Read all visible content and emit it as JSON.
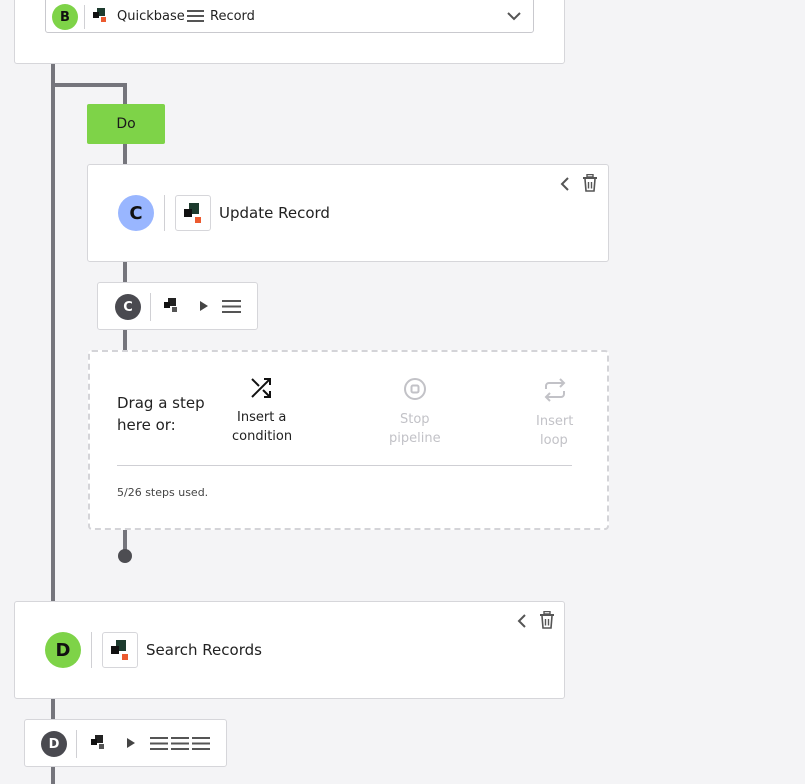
{
  "step_b": {
    "badge": "B",
    "app_name": "Quickbase",
    "entity": "Record",
    "badge_color": "#7ed348"
  },
  "do_block": {
    "label": "Do",
    "color": "#7ed348"
  },
  "step_c": {
    "badge": "C",
    "title": "Update Record",
    "badge_color": "#99b6ff"
  },
  "step_c_mini": {
    "badge": "C"
  },
  "drop_zone": {
    "drag_text_line1": "Drag a step",
    "drag_text_line2": "here or:",
    "insert_condition_line1": "Insert a",
    "insert_condition_line2": "condition",
    "stop_pipeline_line1": "Stop",
    "stop_pipeline_line2": "pipeline",
    "insert_loop_line1": "Insert",
    "insert_loop_line2": "loop",
    "steps_used": "5/26 steps used."
  },
  "step_d": {
    "badge": "D",
    "title": "Search Records",
    "badge_color": "#7ed348"
  },
  "step_d_mini": {
    "badge": "D"
  }
}
